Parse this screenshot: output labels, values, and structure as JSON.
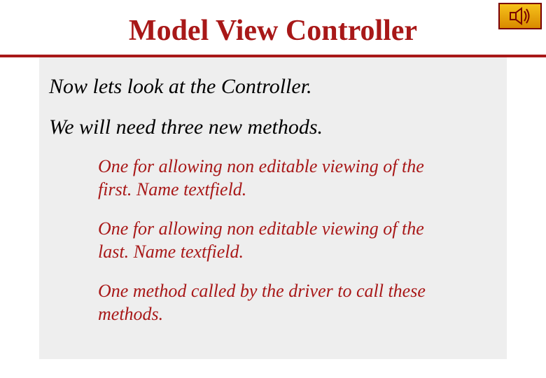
{
  "slide": {
    "title": "Model View Controller",
    "lead1": "Now lets look at the Controller.",
    "lead2": "We will need three new methods.",
    "items": [
      "One for allowing non editable viewing of the first. Name textfield.",
      "One for allowing non editable viewing of the last. Name textfield.",
      "One method called by the driver to call these methods."
    ]
  },
  "badge": {
    "name": "speaker-icon"
  },
  "colors": {
    "accent": "#a81818",
    "badge_bg_top": "#f6c21a",
    "badge_bg_bottom": "#d98a00",
    "badge_border": "#7a0000",
    "content_bg": "#eeeeee"
  }
}
